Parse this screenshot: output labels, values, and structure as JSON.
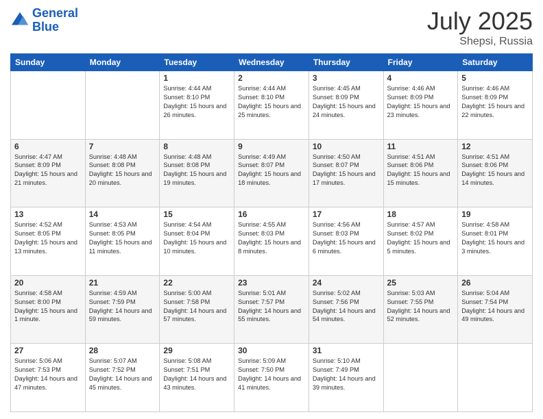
{
  "header": {
    "logo_line1": "General",
    "logo_line2": "Blue",
    "month": "July 2025",
    "location": "Shepsi, Russia"
  },
  "days_of_week": [
    "Sunday",
    "Monday",
    "Tuesday",
    "Wednesday",
    "Thursday",
    "Friday",
    "Saturday"
  ],
  "weeks": [
    [
      {
        "day": "",
        "info": ""
      },
      {
        "day": "",
        "info": ""
      },
      {
        "day": "1",
        "info": "Sunrise: 4:44 AM\nSunset: 8:10 PM\nDaylight: 15 hours and 26 minutes."
      },
      {
        "day": "2",
        "info": "Sunrise: 4:44 AM\nSunset: 8:10 PM\nDaylight: 15 hours and 25 minutes."
      },
      {
        "day": "3",
        "info": "Sunrise: 4:45 AM\nSunset: 8:09 PM\nDaylight: 15 hours and 24 minutes."
      },
      {
        "day": "4",
        "info": "Sunrise: 4:46 AM\nSunset: 8:09 PM\nDaylight: 15 hours and 23 minutes."
      },
      {
        "day": "5",
        "info": "Sunrise: 4:46 AM\nSunset: 8:09 PM\nDaylight: 15 hours and 22 minutes."
      }
    ],
    [
      {
        "day": "6",
        "info": "Sunrise: 4:47 AM\nSunset: 8:09 PM\nDaylight: 15 hours and 21 minutes."
      },
      {
        "day": "7",
        "info": "Sunrise: 4:48 AM\nSunset: 8:08 PM\nDaylight: 15 hours and 20 minutes."
      },
      {
        "day": "8",
        "info": "Sunrise: 4:48 AM\nSunset: 8:08 PM\nDaylight: 15 hours and 19 minutes."
      },
      {
        "day": "9",
        "info": "Sunrise: 4:49 AM\nSunset: 8:07 PM\nDaylight: 15 hours and 18 minutes."
      },
      {
        "day": "10",
        "info": "Sunrise: 4:50 AM\nSunset: 8:07 PM\nDaylight: 15 hours and 17 minutes."
      },
      {
        "day": "11",
        "info": "Sunrise: 4:51 AM\nSunset: 8:06 PM\nDaylight: 15 hours and 15 minutes."
      },
      {
        "day": "12",
        "info": "Sunrise: 4:51 AM\nSunset: 8:06 PM\nDaylight: 15 hours and 14 minutes."
      }
    ],
    [
      {
        "day": "13",
        "info": "Sunrise: 4:52 AM\nSunset: 8:05 PM\nDaylight: 15 hours and 13 minutes."
      },
      {
        "day": "14",
        "info": "Sunrise: 4:53 AM\nSunset: 8:05 PM\nDaylight: 15 hours and 11 minutes."
      },
      {
        "day": "15",
        "info": "Sunrise: 4:54 AM\nSunset: 8:04 PM\nDaylight: 15 hours and 10 minutes."
      },
      {
        "day": "16",
        "info": "Sunrise: 4:55 AM\nSunset: 8:03 PM\nDaylight: 15 hours and 8 minutes."
      },
      {
        "day": "17",
        "info": "Sunrise: 4:56 AM\nSunset: 8:03 PM\nDaylight: 15 hours and 6 minutes."
      },
      {
        "day": "18",
        "info": "Sunrise: 4:57 AM\nSunset: 8:02 PM\nDaylight: 15 hours and 5 minutes."
      },
      {
        "day": "19",
        "info": "Sunrise: 4:58 AM\nSunset: 8:01 PM\nDaylight: 15 hours and 3 minutes."
      }
    ],
    [
      {
        "day": "20",
        "info": "Sunrise: 4:58 AM\nSunset: 8:00 PM\nDaylight: 15 hours and 1 minute."
      },
      {
        "day": "21",
        "info": "Sunrise: 4:59 AM\nSunset: 7:59 PM\nDaylight: 14 hours and 59 minutes."
      },
      {
        "day": "22",
        "info": "Sunrise: 5:00 AM\nSunset: 7:58 PM\nDaylight: 14 hours and 57 minutes."
      },
      {
        "day": "23",
        "info": "Sunrise: 5:01 AM\nSunset: 7:57 PM\nDaylight: 14 hours and 55 minutes."
      },
      {
        "day": "24",
        "info": "Sunrise: 5:02 AM\nSunset: 7:56 PM\nDaylight: 14 hours and 54 minutes."
      },
      {
        "day": "25",
        "info": "Sunrise: 5:03 AM\nSunset: 7:55 PM\nDaylight: 14 hours and 52 minutes."
      },
      {
        "day": "26",
        "info": "Sunrise: 5:04 AM\nSunset: 7:54 PM\nDaylight: 14 hours and 49 minutes."
      }
    ],
    [
      {
        "day": "27",
        "info": "Sunrise: 5:06 AM\nSunset: 7:53 PM\nDaylight: 14 hours and 47 minutes."
      },
      {
        "day": "28",
        "info": "Sunrise: 5:07 AM\nSunset: 7:52 PM\nDaylight: 14 hours and 45 minutes."
      },
      {
        "day": "29",
        "info": "Sunrise: 5:08 AM\nSunset: 7:51 PM\nDaylight: 14 hours and 43 minutes."
      },
      {
        "day": "30",
        "info": "Sunrise: 5:09 AM\nSunset: 7:50 PM\nDaylight: 14 hours and 41 minutes."
      },
      {
        "day": "31",
        "info": "Sunrise: 5:10 AM\nSunset: 7:49 PM\nDaylight: 14 hours and 39 minutes."
      },
      {
        "day": "",
        "info": ""
      },
      {
        "day": "",
        "info": ""
      }
    ]
  ]
}
